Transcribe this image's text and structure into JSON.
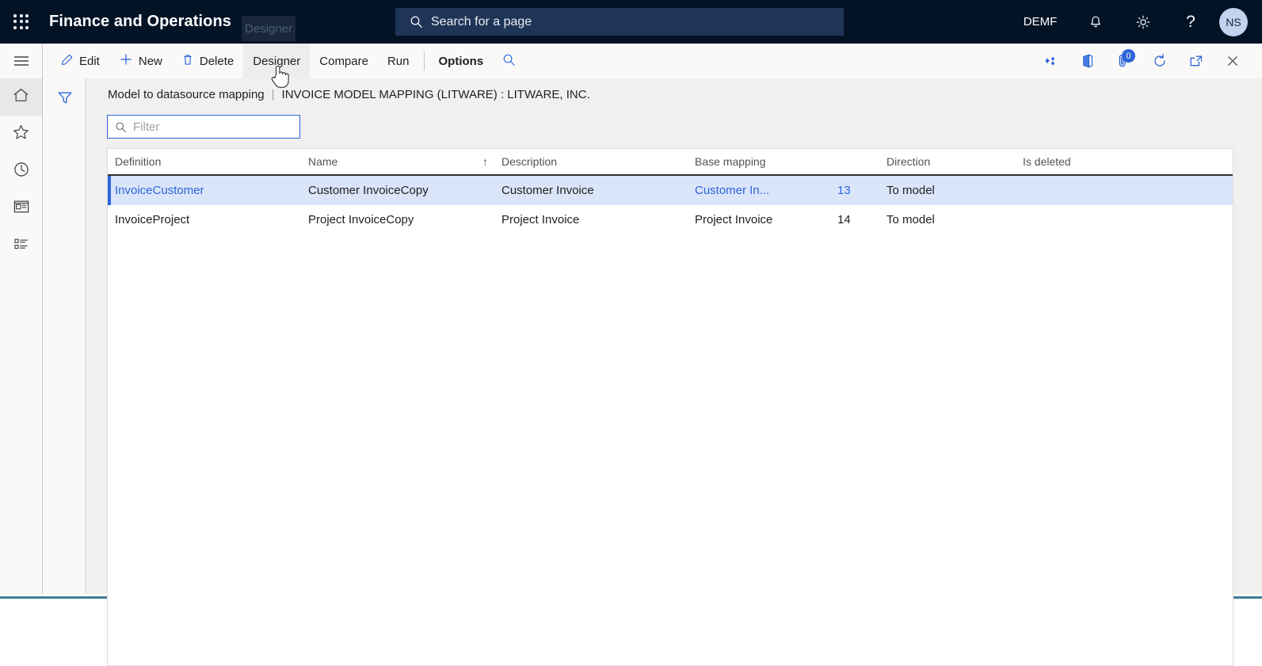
{
  "topbar": {
    "waffle_icon": "app-launcher-icon",
    "brand": "Finance and Operations",
    "search": {
      "icon": "search-icon",
      "placeholder": "Search for a page"
    },
    "company": "DEMF",
    "notifications_icon": "bell-icon",
    "settings_icon": "gear-icon",
    "help_icon": "question-mark-icon",
    "avatar_initials": "NS",
    "tooltip": "Designer"
  },
  "commandbar": {
    "menu_icon": "hamburger-icon",
    "buttons": [
      {
        "label": "Edit",
        "icon": "pencil-icon"
      },
      {
        "label": "New",
        "icon": "plus-icon"
      },
      {
        "label": "Delete",
        "icon": "trash-icon"
      },
      {
        "label": "Designer",
        "icon": ""
      },
      {
        "label": "Compare",
        "icon": ""
      },
      {
        "label": "Run",
        "icon": ""
      },
      {
        "label": "Options",
        "icon": ""
      }
    ],
    "search_icon": "search-icon",
    "right_icons": [
      {
        "name": "share-diamond-icon",
        "badge": ""
      },
      {
        "name": "office-app-icon",
        "badge": ""
      },
      {
        "name": "attachments-icon",
        "badge": "0"
      },
      {
        "name": "refresh-icon",
        "badge": ""
      },
      {
        "name": "open-in-new-window-icon",
        "badge": ""
      },
      {
        "name": "close-icon",
        "badge": ""
      }
    ]
  },
  "rail": {
    "items": [
      {
        "name": "home-icon"
      },
      {
        "name": "favorites-star-icon"
      },
      {
        "name": "recent-clock-icon"
      },
      {
        "name": "workspaces-icon"
      },
      {
        "name": "modules-list-icon"
      }
    ]
  },
  "filterpane": {
    "funnel_icon": "filter-funnel-icon"
  },
  "page": {
    "title": "Model to datasource mapping",
    "separator": "|",
    "subtitle": "INVOICE MODEL MAPPING (LITWARE) : LITWARE, INC.",
    "filter": {
      "icon": "search-icon",
      "placeholder": "Filter",
      "value": ""
    }
  },
  "grid": {
    "columns": [
      {
        "key": "definition",
        "label": "Definition",
        "sorted": false
      },
      {
        "key": "name",
        "label": "Name",
        "sorted": true,
        "sort_arrow": "↑"
      },
      {
        "key": "description",
        "label": "Description",
        "sorted": false
      },
      {
        "key": "base_mapping",
        "label": "Base mapping",
        "sorted": false
      },
      {
        "key": "record_id",
        "label": "",
        "sorted": false
      },
      {
        "key": "direction",
        "label": "Direction",
        "sorted": false
      },
      {
        "key": "is_deleted",
        "label": "Is deleted",
        "sorted": false
      }
    ],
    "rows": [
      {
        "definition": "InvoiceCustomer",
        "name": "Customer InvoiceCopy",
        "description": "Customer Invoice",
        "base_mapping": "Customer In...",
        "record_id": "13",
        "direction": "To model",
        "is_deleted": "",
        "selected": true
      },
      {
        "definition": "InvoiceProject",
        "name": "Project InvoiceCopy",
        "description": "Project Invoice",
        "base_mapping": "Project Invoice",
        "record_id": "14",
        "direction": "To model",
        "is_deleted": "",
        "selected": false
      }
    ]
  },
  "colors": {
    "nav_background": "#031326",
    "accent_blue": "#2b65d9",
    "selected_row": "#dbe5fa",
    "command_bar": "#faf9f8",
    "content_background": "#f1f0ef"
  }
}
